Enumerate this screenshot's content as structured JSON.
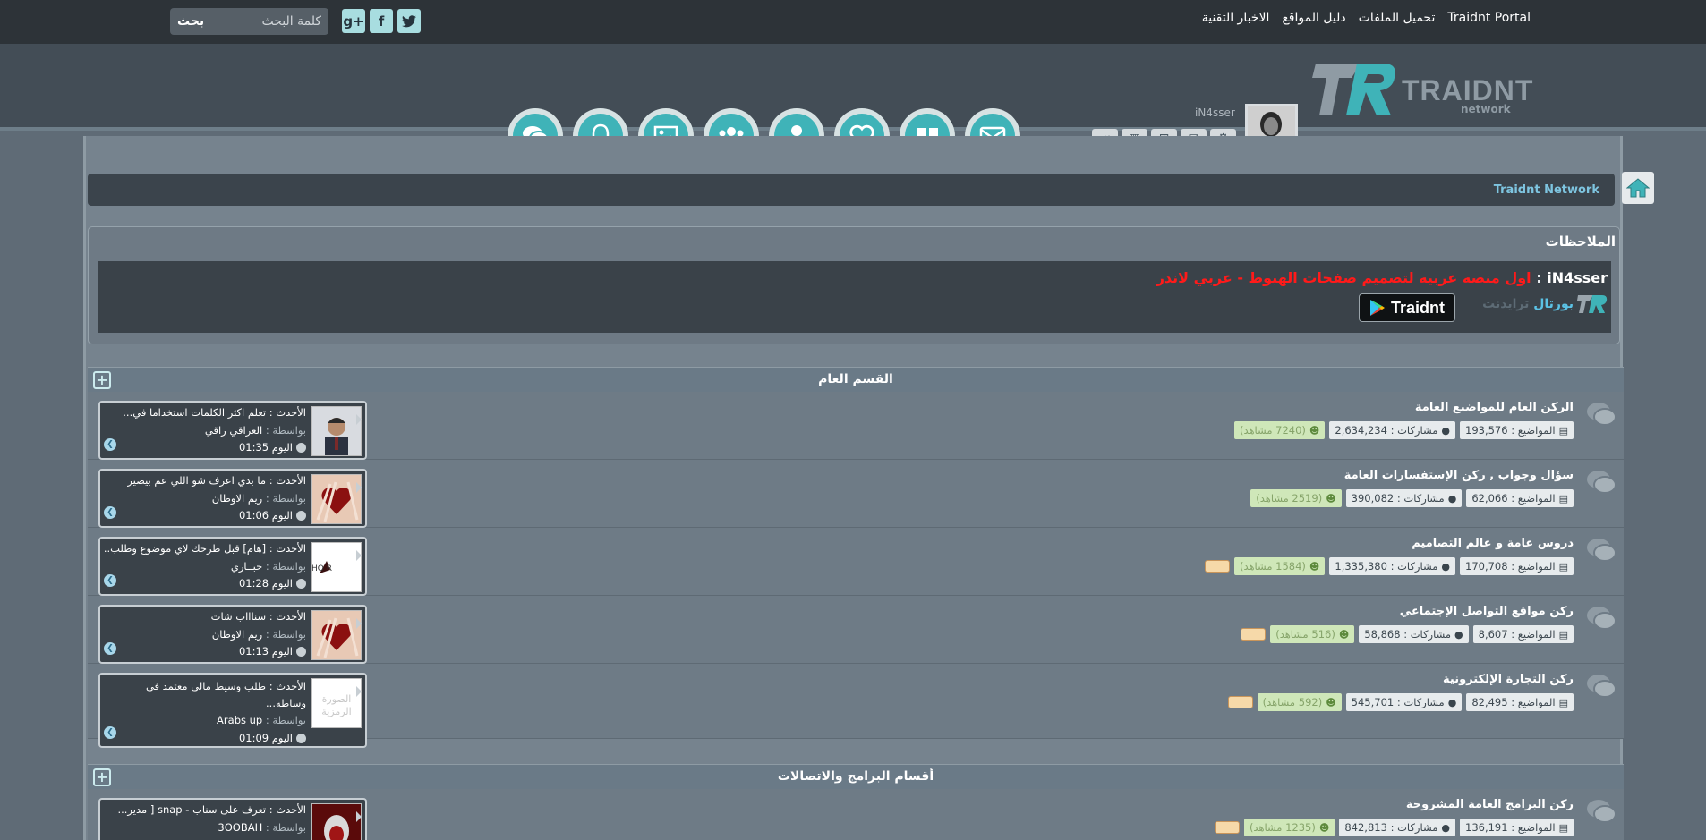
{
  "top_nav": [
    "Traidnt Portal",
    "تحميل الملفات",
    "دليل المواقع",
    "الاخبار التقنية"
  ],
  "social": [
    "twitter-icon",
    "facebook-icon",
    "google-plus-icon"
  ],
  "search": {
    "placeholder": "كلمة البحث",
    "button": "بحث"
  },
  "logo": {
    "word": "TRAIDNT",
    "sub": "network",
    "reg": "®"
  },
  "user": {
    "name": "iN4sser"
  },
  "header_icons": [
    "envelope-icon",
    "quote-icon",
    "heart-icon",
    "user-icon",
    "users-icon",
    "image-icon",
    "bell-icon",
    "chat-icon"
  ],
  "breadcrumb": {
    "label": "Traidnt Network"
  },
  "notes": {
    "title": "الملاحظات",
    "who": "iN4sser",
    "sep": " : ",
    "message": "اول منصه عربيه لتصميم صفحات الهبوط - عربي لاندر",
    "portal_a": "بورتال",
    "portal_b": "ترايدنت",
    "store_label": "Traidnt"
  },
  "sections": [
    {
      "title": "القسم العام",
      "forums": [
        {
          "name": "الركن العام للمواضيع العامة",
          "topics": "المواضيع : 193,576",
          "posts": "مشاركات : 2,634,234",
          "views": "(7240 مشاهد)",
          "folder": false,
          "last": {
            "title": "الأحدث : تعلم اكثر الكلمات استخداما في...",
            "by_k": "بواسطة : ",
            "by": "العراقي راقي",
            "time": "اليوم 01:35"
          }
        },
        {
          "name": "سؤال وجواب , ركن الإستفسارات العامة",
          "topics": "المواضيع : 62,066",
          "posts": "مشاركات : 390,082",
          "views": "(2519 مشاهد)",
          "folder": false,
          "last": {
            "title": "الأحدث : ما بدي اعرف شو اللي عم بيصير",
            "by_k": "بواسطة : ",
            "by": "ريم الاوطان",
            "time": "اليوم 01:06"
          }
        },
        {
          "name": "دروس عامة و عالم التصاميم",
          "topics": "المواضيع : 170,708",
          "posts": "مشاركات : 1,335,380",
          "views": "(1584 مشاهد)",
          "folder": true,
          "last": {
            "title": "الأحدث : [هام] قبل طرحك لاي موضوع وطلب...",
            "by_k": "بواسطة : ",
            "by": "حبــاري",
            "time": "اليوم 01:28"
          }
        },
        {
          "name": "ركن مواقع التواصل الإجتماعي",
          "topics": "المواضيع : 8,607",
          "posts": "مشاركات : 58,868",
          "views": "(516 مشاهد)",
          "folder": true,
          "last": {
            "title": "الأحدث : سناااب شات",
            "by_k": "بواسطة : ",
            "by": "ريم الاوطان",
            "time": "اليوم 01:13"
          }
        },
        {
          "name": "ركن التجارة الإلكترونية",
          "topics": "المواضيع : 82,495",
          "posts": "مشاركات : 545,701",
          "views": "(592 مشاهد)",
          "folder": true,
          "last": {
            "title": "الأحدث : طلب وسيط مالى معتمد فى وساطه...",
            "by_k": "بواسطة : ",
            "by": "Arabs up",
            "time": "اليوم 01:09"
          }
        }
      ]
    },
    {
      "title": "أقسام البرامج والاتصالات",
      "forums": [
        {
          "name": "ركن البرامج العامة المشروحة",
          "topics": "المواضيع : 136,191",
          "posts": "مشاركات : 842,813",
          "views": "(1235 مشاهد)",
          "folder": true,
          "last": {
            "title": "الأحدث : تعرف على سناب - snap [ مدير...",
            "by_k": "بواسطة : ",
            "by": "3OOBAH",
            "time": ""
          }
        }
      ]
    }
  ],
  "thumb_alt": "الصورة الرمزية",
  "colors": {
    "accent": "#3fb3b8",
    "alert": "#ff1a1a",
    "link": "#7ec5e0"
  }
}
